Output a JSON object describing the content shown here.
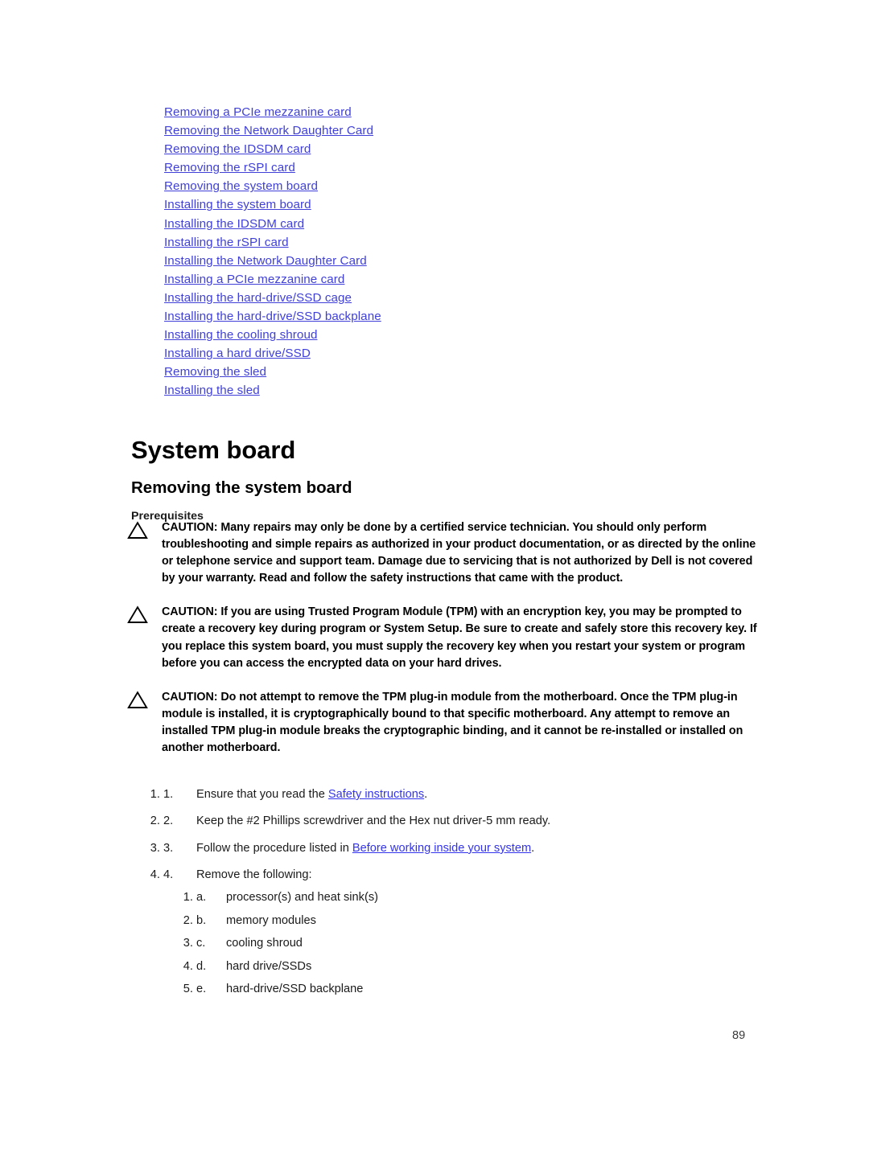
{
  "document": {
    "section_heading": "System board",
    "topic_heading": "Removing the system board",
    "subsection_heading": "Prerequisites",
    "page_number": "89"
  },
  "colors": {
    "toc_link": "#4040d8",
    "inline_link": "#3333ee",
    "body_text": "#1a1a1a",
    "heading_text": "#000000",
    "page_background": "#ffffff"
  },
  "toc": {
    "links": [
      "Removing a PCIe mezzanine card",
      "Removing the Network Daughter Card",
      "Removing the IDSDM card",
      "Removing the rSPI card",
      "Removing the system board",
      "Installing the system board",
      "Installing the IDSDM card",
      "Installing the rSPI card",
      "Installing the Network Daughter Card",
      "Installing a PCIe mezzanine card",
      "Installing the hard-drive/SSD cage",
      "Installing the hard-drive/SSD backplane",
      "Installing the cooling shroud",
      "Installing a hard drive/SSD",
      "Removing the sled",
      "Installing the sled"
    ]
  },
  "cautions": [
    {
      "icon": "warning-triangle-icon",
      "text": "CAUTION: Many repairs may only be done by a certified service technician. You should only perform troubleshooting and simple repairs as authorized in your product documentation, or as directed by the online or telephone service and support team. Damage due to servicing that is not authorized by Dell is not covered by your warranty. Read and follow the safety instructions that came with the product."
    },
    {
      "icon": "warning-triangle-icon",
      "text": "CAUTION: If you are using Trusted Program Module (TPM) with an encryption key, you may be prompted to create a recovery key during program or System Setup. Be sure to create and safely store this recovery key. If you replace this system board, you must supply the recovery key when you restart your system or program before you can access the encrypted data on your hard drives."
    },
    {
      "icon": "warning-triangle-icon",
      "text": "CAUTION: Do not attempt to remove the TPM plug-in module from the motherboard. Once the TPM plug-in module is installed, it is cryptographically bound to that specific motherboard. Any attempt to remove an installed TPM plug-in module breaks the cryptographic binding, and it cannot be re-installed or installed on another motherboard."
    }
  ],
  "procedure": {
    "items": [
      {
        "marker": "1.",
        "prefix": "Ensure that you read the ",
        "link": "Safety instructions",
        "suffix": "."
      },
      {
        "marker": "2.",
        "prefix": "Keep the #2 Phillips screwdriver and the Hex nut driver-5 mm ready.",
        "link": "",
        "suffix": ""
      },
      {
        "marker": "3.",
        "prefix": "Follow the procedure listed in ",
        "link": "Before working inside your system",
        "suffix": "."
      },
      {
        "marker": "4.",
        "prefix": "Remove the following:",
        "link": "",
        "suffix": ""
      }
    ],
    "sub_items": [
      {
        "marker": "a.",
        "text": "processor(s) and heat sink(s)"
      },
      {
        "marker": "b.",
        "text": "memory modules"
      },
      {
        "marker": "c.",
        "text": "cooling shroud"
      },
      {
        "marker": "d.",
        "text": "hard drive/SSDs"
      },
      {
        "marker": "e.",
        "text": "hard-drive/SSD backplane"
      }
    ]
  }
}
